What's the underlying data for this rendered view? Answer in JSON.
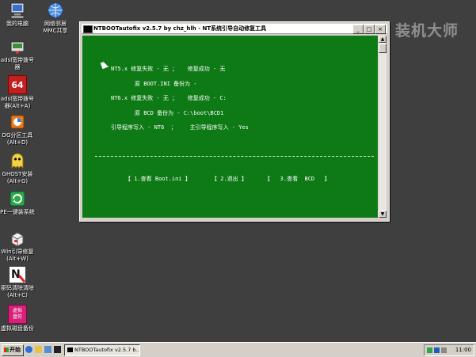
{
  "desktop": {
    "icons": [
      {
        "id": "my-computer",
        "label": "我的电脑",
        "icon": "computer-icon"
      },
      {
        "id": "network",
        "label": "网络邻居\nMMC共享",
        "icon": "network-globe-icon"
      },
      {
        "id": "adsl-dial",
        "label": "adsl宽带拨号\n器",
        "icon": "adsl-icon"
      },
      {
        "id": "64",
        "label": "adsl宽带拨号\n器(Alt+A)",
        "icon": "sixty-four-icon",
        "badge": "64"
      },
      {
        "id": "dg-partition",
        "label": "DG分区工具\n(Alt+D)",
        "icon": "disk-partition-icon"
      },
      {
        "id": "ghost",
        "label": "GHOST安装\n(Alt+G)",
        "icon": "ghost-icon"
      },
      {
        "id": "pe-oneclick",
        "label": "PE一键装系统",
        "icon": "oneclick-install-icon"
      },
      {
        "id": "win-boot",
        "label": "Win引导修复\n(Alt+W)",
        "icon": "boot-repair-icon"
      },
      {
        "id": "ntpwedit",
        "label": "密码清除清除\n(Alt+C)",
        "icon": "password-clear-icon"
      },
      {
        "id": "disk-tool",
        "label": "虚拟磁盘备份",
        "icon": "disk-tool-icon",
        "badge": "虚拟\n盘符"
      }
    ]
  },
  "watermark": "装机大师",
  "window": {
    "title": "NTBOOTautofix v2.5.7 by chz_hlh - NT系统引导自动修复工具",
    "buttons": {
      "minimize": "_",
      "maximize": "□",
      "close": "×"
    },
    "console_lines": [
      "NT5.x 修复失败 - 无 ；   修复成功 - 无",
      "原 BOOT.INI 备份为 -",
      "NT6.x 修复失败 - 无 ；   修复成功 - C:",
      "原 BCD 备份为 - C:\\boot\\BCD1",
      "引导程序写入 - NT6  ；    主引导程序写入 - Yes"
    ],
    "menu": {
      "item1": "【 1.查看 Boot.ini 】",
      "item2": "【 2.退出 】",
      "item3": "【   3.查看  BCD   】"
    },
    "scroll": {
      "up": "▲",
      "down": "▼"
    }
  },
  "taskbar": {
    "start_label": "开始",
    "task_label": "NTBOOTautofix v2.5.7 b...",
    "clock": "11:00",
    "quicklaunch": [
      "ie-icon",
      "folder-icon",
      "desktop-icon",
      "cmd-icon",
      "tools-icon"
    ]
  }
}
